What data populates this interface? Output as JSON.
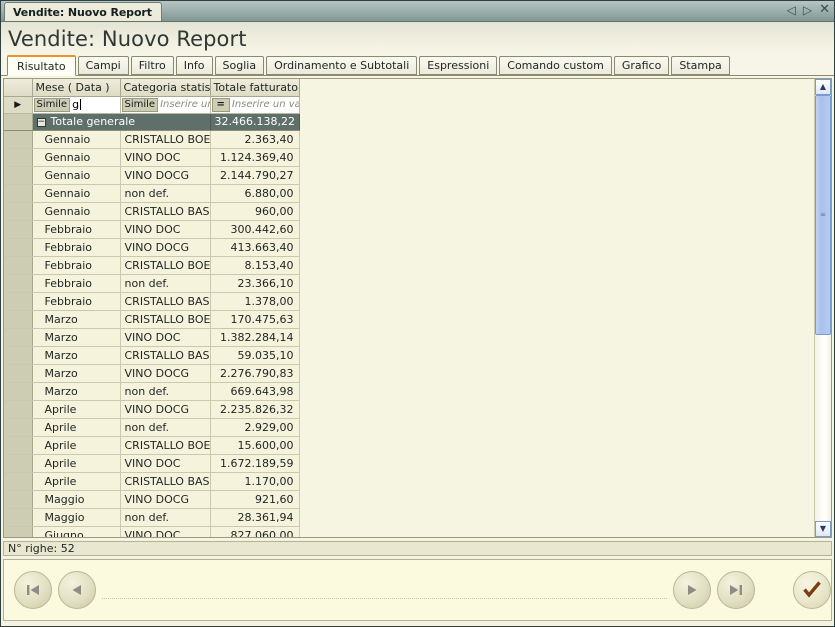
{
  "window": {
    "tab_title": "Vendite: Nuovo Report",
    "controls": {
      "prev": "◁",
      "next": "▷",
      "close": "✕"
    }
  },
  "page": {
    "title": "Vendite: Nuovo Report"
  },
  "tabs": [
    {
      "label": "Risultato",
      "active": true
    },
    {
      "label": "Campi",
      "active": false
    },
    {
      "label": "Filtro",
      "active": false
    },
    {
      "label": "Info",
      "active": false
    },
    {
      "label": "Soglia",
      "active": false
    },
    {
      "label": "Ordinamento e Subtotali",
      "active": false
    },
    {
      "label": "Espressioni",
      "active": false
    },
    {
      "label": "Comando custom",
      "active": false
    },
    {
      "label": "Grafico",
      "active": false
    },
    {
      "label": "Stampa",
      "active": false
    }
  ],
  "grid": {
    "columns": [
      {
        "key": "mese",
        "header": "Mese ( Data )"
      },
      {
        "key": "categoria",
        "header": "Categoria statistic"
      },
      {
        "key": "totale",
        "header": "Totale fatturato"
      }
    ],
    "filter_row": {
      "mese": {
        "operator": "Simile",
        "value": "g",
        "placeholder": ""
      },
      "categoria": {
        "operator": "Simile",
        "value": "",
        "placeholder": "Inserire un"
      },
      "totale": {
        "operator": "=",
        "value": "",
        "placeholder": "Inserire un val"
      }
    },
    "total_row": {
      "expander": "−",
      "label": "Totale generale",
      "value": "32.466.138,22"
    },
    "rows": [
      {
        "mese": "Gennaio",
        "categoria": "CRISTALLO BOEM",
        "totale": "2.363,40"
      },
      {
        "mese": "Gennaio",
        "categoria": "VINO DOC",
        "totale": "1.124.369,40"
      },
      {
        "mese": "Gennaio",
        "categoria": "VINO DOCG",
        "totale": "2.144.790,27"
      },
      {
        "mese": "Gennaio",
        "categoria": "non def.",
        "totale": "6.880,00"
      },
      {
        "mese": "Gennaio",
        "categoria": "CRISTALLO BASE",
        "totale": "960,00"
      },
      {
        "mese": "Febbraio",
        "categoria": "VINO DOC",
        "totale": "300.442,60"
      },
      {
        "mese": "Febbraio",
        "categoria": "VINO DOCG",
        "totale": "413.663,40"
      },
      {
        "mese": "Febbraio",
        "categoria": "CRISTALLO BOEM",
        "totale": "8.153,40"
      },
      {
        "mese": "Febbraio",
        "categoria": "non def.",
        "totale": "23.366,10"
      },
      {
        "mese": "Febbraio",
        "categoria": "CRISTALLO BASE",
        "totale": "1.378,00"
      },
      {
        "mese": "Marzo",
        "categoria": "CRISTALLO BOEM",
        "totale": "170.475,63"
      },
      {
        "mese": "Marzo",
        "categoria": "VINO DOC",
        "totale": "1.382.284,14"
      },
      {
        "mese": "Marzo",
        "categoria": "CRISTALLO BASE",
        "totale": "59.035,10"
      },
      {
        "mese": "Marzo",
        "categoria": "VINO DOCG",
        "totale": "2.276.790,83"
      },
      {
        "mese": "Marzo",
        "categoria": "non def.",
        "totale": "669.643,98"
      },
      {
        "mese": "Aprile",
        "categoria": "VINO DOCG",
        "totale": "2.235.826,32"
      },
      {
        "mese": "Aprile",
        "categoria": "non def.",
        "totale": "2.929,00"
      },
      {
        "mese": "Aprile",
        "categoria": "CRISTALLO BOEM",
        "totale": "15.600,00"
      },
      {
        "mese": "Aprile",
        "categoria": "VINO DOC",
        "totale": "1.672.189,59"
      },
      {
        "mese": "Aprile",
        "categoria": "CRISTALLO BASE",
        "totale": "1.170,00"
      },
      {
        "mese": "Maggio",
        "categoria": "VINO DOCG",
        "totale": "921,60"
      },
      {
        "mese": "Maggio",
        "categoria": "non def.",
        "totale": "28.361,94"
      },
      {
        "mese": "Giugno",
        "categoria": "VINO DOC",
        "totale": "827.060,00"
      }
    ]
  },
  "statusbar": {
    "text": "N° righe: 52"
  },
  "navigator": {
    "first_label": "Primo",
    "prev_label": "Precedente",
    "next_label": "Successivo",
    "last_label": "Ultimo",
    "confirm_label": "Conferma"
  }
}
